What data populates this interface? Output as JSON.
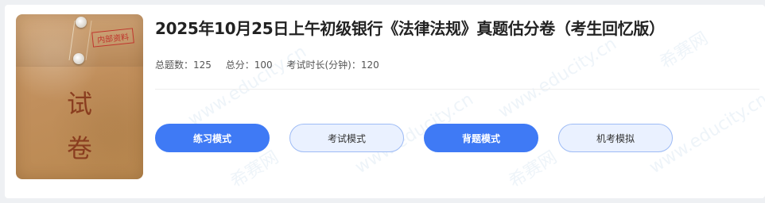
{
  "cover": {
    "stamp": "内部资料",
    "char1": "试",
    "char2": "卷"
  },
  "exam": {
    "title": "2025年10月25日上午初级银行《法律法规》真题估分卷（考生回忆版）",
    "total_questions_label": "总题数：125",
    "total_score_label": "总分：100",
    "duration_label": "考试时长(分钟)：120"
  },
  "modes": {
    "practice": "练习模式",
    "exam": "考试模式",
    "memorize": "背题模式",
    "computer": "机考模拟"
  },
  "colors": {
    "primary": "#3f7af5",
    "secondary_bg": "#eaf1ff",
    "secondary_border": "#9dbbf5"
  },
  "watermark": {
    "text": "www.educity.cn",
    "brand": "希赛网"
  }
}
